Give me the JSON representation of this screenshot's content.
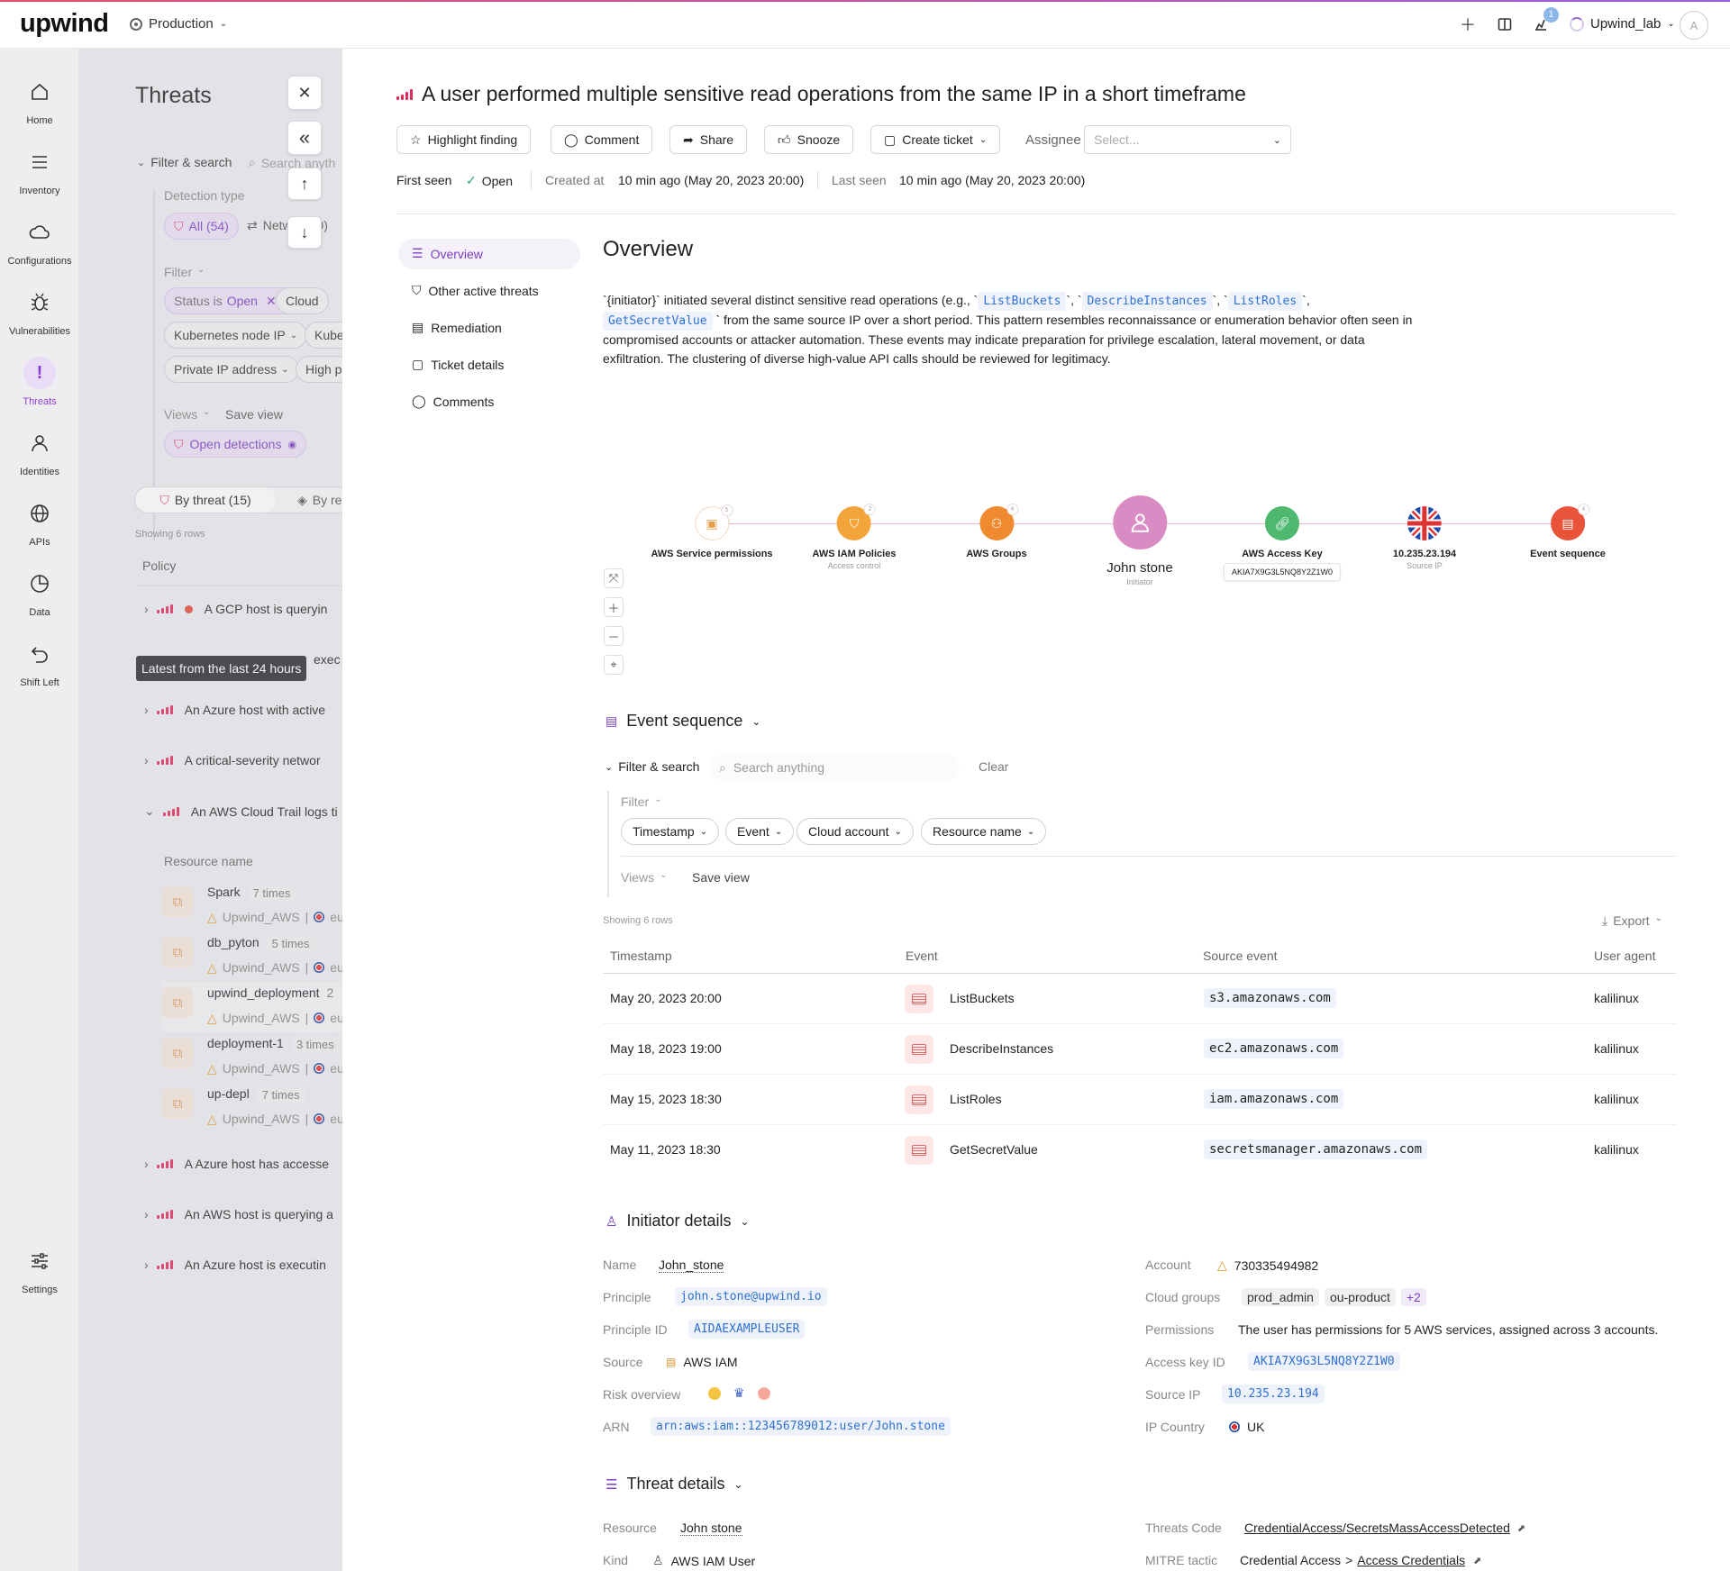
{
  "topbar": {
    "logo": "upwind",
    "environment": "Production",
    "notification_count": "1",
    "account": "Upwind_lab",
    "avatar_initial": "A"
  },
  "rail": {
    "items": [
      {
        "label": "Home",
        "icon": "home-icon"
      },
      {
        "label": "Inventory",
        "icon": "inventory-icon"
      },
      {
        "label": "Configurations",
        "icon": "cloud-icon"
      },
      {
        "label": "Vulnerabilities",
        "icon": "bug-icon"
      },
      {
        "label": "Threats",
        "icon": "threat-icon"
      },
      {
        "label": "Identities",
        "icon": "person-icon"
      },
      {
        "label": "APIs",
        "icon": "globe-icon"
      },
      {
        "label": "Data",
        "icon": "pie-icon"
      },
      {
        "label": "Shift Left",
        "icon": "undo-icon"
      },
      {
        "label": "Settings",
        "icon": "sliders-icon"
      }
    ]
  },
  "panel": {
    "title": "Threats",
    "filter_search": "Filter & search",
    "search_placeholder": "Search anyth",
    "detection_type": "Detection type",
    "all_chip": "All (54)",
    "net_chip": "Netw",
    "net_count": "10)",
    "filter": "Filter",
    "chips": {
      "status_prefix": "Status is",
      "status_value": "Open",
      "cloud": "Cloud",
      "k8s": "Kubernetes node IP",
      "kube": "Kube",
      "private_ip": "Private IP address",
      "high": "High p"
    },
    "views": "Views",
    "save_view": "Save view",
    "open_detections": "Open detections",
    "by_threat": "By threat (15)",
    "by_re": "By re",
    "showing": "Showing 6 rows",
    "policy_header": "Policy",
    "tooltip": "Latest from the last 24 hours",
    "tooltip_tail": "exec",
    "rows": [
      {
        "text": "A GCP host is queryin"
      },
      {
        "text": "An Azure host with active"
      },
      {
        "text": "A critical-severity networ"
      },
      {
        "text": "An AWS Cloud Trail logs ti"
      },
      {
        "text": "A Azure host has accesse"
      },
      {
        "text": "An AWS host is querying a"
      },
      {
        "text": "An Azure host is executin"
      }
    ],
    "resource_header": "Resource name",
    "resources": [
      {
        "name": "Spark",
        "times": "7 times",
        "account": "Upwind_AWS",
        "region": "eu"
      },
      {
        "name": "db_pyton",
        "times": "5 times",
        "account": "Upwind_AWS",
        "region": "eu"
      },
      {
        "name": "upwind_deployment",
        "times": "2",
        "account": "Upwind_AWS",
        "region": "eu"
      },
      {
        "name": "deployment-1",
        "times": "3 times",
        "account": "Upwind_AWS",
        "region": "eu"
      },
      {
        "name": "up-depl",
        "times": "7 times",
        "account": "Upwind_AWS",
        "region": "eu"
      }
    ]
  },
  "detail": {
    "title": "A user performed multiple sensitive read operations from the same IP in a short timeframe",
    "buttons": {
      "highlight": "Highlight finding",
      "comment": "Comment",
      "share": "Share",
      "snooze": "Snooze",
      "create_ticket": "Create ticket",
      "assignee": "Assignee",
      "assignee_placeholder": "Select..."
    },
    "meta": {
      "first_seen": "First seen",
      "status": "Open",
      "created_label": "Created at",
      "created_value": "10 min ago (May 20, 2023 20:00)",
      "last_label": "Last seen",
      "last_value": "10 min ago (May 20, 2023 20:00)"
    },
    "nav": [
      "Overview",
      "Other active threats",
      "Remediation",
      "Ticket details",
      "Comments"
    ],
    "overview": {
      "heading": "Overview",
      "p1": "`{initiator}` initiated several distinct sensitive read operations (e.g., `",
      "c1": "ListBuckets",
      "sep1": "`, `",
      "c2": "DescribeInstances",
      "sep2": "`, `",
      "c3": "ListRoles",
      "sep3": "`,",
      "c4": "GetSecretValue",
      "p2": "` from the same source IP over a short period. This pattern resembles reconnaissance or enumeration behavior often seen in compromised accounts or attacker automation. These events may indicate preparation for privilege escalation, lateral movement, or data exfiltration. The clustering of diverse high-value API calls should be reviewed for legitimacy."
    },
    "graph": {
      "nodes": [
        {
          "label": "AWS Service permissions",
          "sub": "",
          "badge": "5",
          "icon": "chip-icon"
        },
        {
          "label": "AWS IAM Policies",
          "sub": "Access control",
          "badge": "2",
          "icon": "shield-icon"
        },
        {
          "label": "AWS Groups",
          "sub": "",
          "badge": "4",
          "icon": "group-icon"
        },
        {
          "label": "John stone",
          "sub": "Initiator",
          "badge": "",
          "icon": "person-icon"
        },
        {
          "label": "AWS Access Key",
          "sub": "AKIA7X9G3L5NQ8Y2Z1W0",
          "badge": "",
          "icon": "link-icon"
        },
        {
          "label": "10.235.23.194",
          "sub": "Source IP",
          "badge": "",
          "icon": "uk-flag-icon"
        },
        {
          "label": "Event sequence",
          "sub": "",
          "badge": "4",
          "icon": "list-icon"
        }
      ]
    },
    "events": {
      "heading": "Event sequence",
      "filter_search": "Filter & search",
      "search_placeholder": "Search anything",
      "clear": "Clear",
      "filter": "Filter",
      "chips": [
        "Timestamp",
        "Event",
        "Cloud account",
        "Resource name"
      ],
      "views": "Views",
      "save_view": "Save view",
      "showing": "Showing 6 rows",
      "export": "Export",
      "columns": [
        "Timestamp",
        "Event",
        "Source event",
        "User agent"
      ],
      "rows": [
        {
          "timestamp": "May 20, 2023 20:00",
          "event": "ListBuckets",
          "source": "s3.amazonaws.com",
          "agent": "kalilinux"
        },
        {
          "timestamp": "May 18, 2023 19:00",
          "event": "DescribeInstances",
          "source": "ec2.amazonaws.com",
          "agent": "kalilinux"
        },
        {
          "timestamp": "May 15, 2023 18:30",
          "event": "ListRoles",
          "source": "iam.amazonaws.com",
          "agent": "kalilinux"
        },
        {
          "timestamp": "May 11, 2023 18:30",
          "event": "GetSecretValue",
          "source": "secretsmanager.amazonaws.com",
          "agent": "kalilinux"
        }
      ]
    },
    "initiator": {
      "heading": "Initiator details",
      "name_label": "Name",
      "name": "John_stone",
      "principle_label": "Principle",
      "principle": "john.stone@upwind.io",
      "principle_id_label": "Principle ID",
      "principle_id": "AIDAEXAMPLEUSER",
      "source_label": "Source",
      "source": "AWS IAM",
      "risk_label": "Risk overview",
      "arn_label": "ARN",
      "arn": "arn:aws:iam::123456789012:user/John.stone",
      "account_label": "Account",
      "account": "730335494982",
      "groups_label": "Cloud groups",
      "group1": "prod_admin",
      "group2": "ou-product",
      "group_more": "+2",
      "permissions_label": "Permissions",
      "permissions": "The user has permissions for 5 AWS services, assigned across 3 accounts.",
      "access_key_label": "Access key ID",
      "access_key": "AKIA7X9G3L5NQ8Y2Z1W0",
      "source_ip_label": "Source IP",
      "source_ip": "10.235.23.194",
      "country_label": "IP Country",
      "country": "UK"
    },
    "threat": {
      "heading": "Threat details",
      "resource_label": "Resource",
      "resource": "John stone",
      "kind_label": "Kind",
      "kind": "AWS IAM User",
      "code_label": "Threats Code",
      "code": "CredentialAccess/SecretsMassAccessDetected",
      "mitre_label": "MITRE tactic",
      "mitre_tactic": "Credential Access",
      "mitre_sep": ">",
      "mitre_technique": "Access Credentials"
    }
  },
  "colors": {
    "accent": "#8a3fd1",
    "severity": "#e52a5a",
    "link": "#2f6fd3"
  }
}
